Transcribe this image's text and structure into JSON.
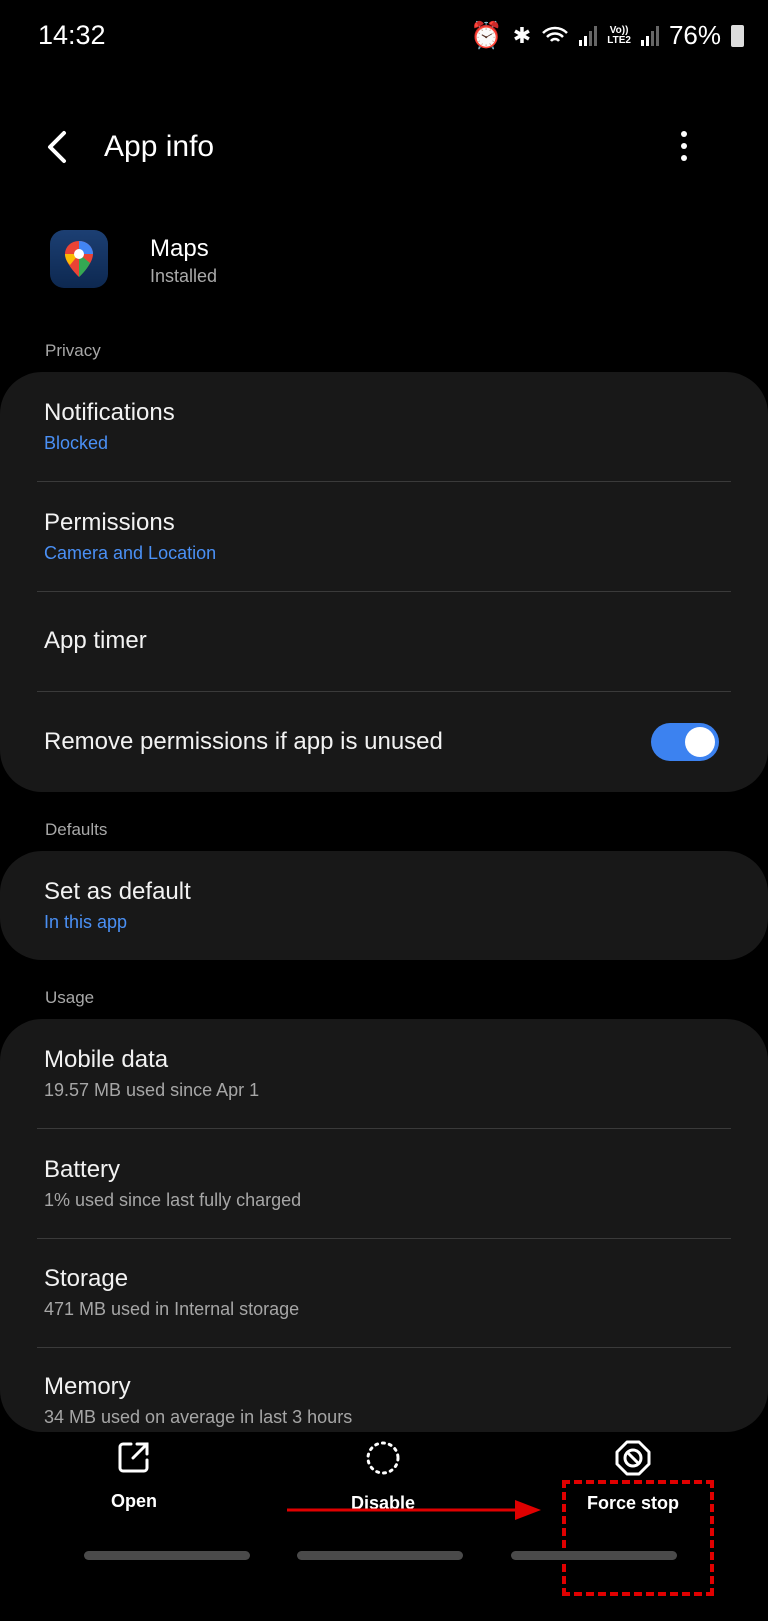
{
  "status_bar": {
    "time": "14:32",
    "lte_top": "Vo))",
    "lte_bottom": "LTE2",
    "battery": "76%",
    "icons": [
      "alarm-icon",
      "bluetooth-icon",
      "wifi-icon",
      "signal-icon",
      "signal-icon",
      "battery-icon"
    ]
  },
  "header": {
    "title": "App info"
  },
  "app": {
    "name": "Maps",
    "status": "Installed"
  },
  "sections": {
    "privacy": {
      "label": "Privacy",
      "items": [
        {
          "title": "Notifications",
          "subtitle": "Blocked"
        },
        {
          "title": "Permissions",
          "subtitle": "Camera and Location"
        },
        {
          "title": "App timer"
        },
        {
          "title": "Remove permissions if app is unused",
          "toggle": true
        }
      ]
    },
    "defaults": {
      "label": "Defaults",
      "items": [
        {
          "title": "Set as default",
          "subtitle": "In this app"
        }
      ]
    },
    "usage": {
      "label": "Usage",
      "items": [
        {
          "title": "Mobile data",
          "subtitle": "19.57 MB used since Apr 1"
        },
        {
          "title": "Battery",
          "subtitle": "1% used since last fully charged"
        },
        {
          "title": "Storage",
          "subtitle": "471 MB used in Internal storage"
        },
        {
          "title": "Memory",
          "subtitle": "34 MB used on average in last 3 hours"
        }
      ]
    }
  },
  "bottom_bar": {
    "open": "Open",
    "disable": "Disable",
    "force_stop": "Force stop"
  },
  "colors": {
    "accent": "#3c82f0",
    "link": "#4a90f5",
    "annotation": "#e00000",
    "card": "#181818"
  }
}
